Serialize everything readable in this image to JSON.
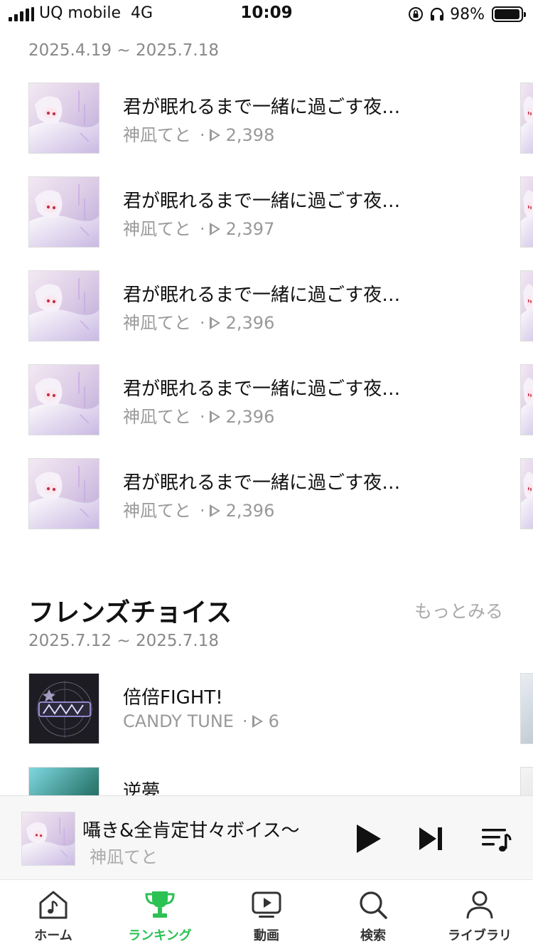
{
  "status_bar": {
    "carrier": "UQ mobile",
    "network": "4G",
    "time": "10:09",
    "battery_percent": "98%",
    "battery_level": 0.98
  },
  "section1": {
    "date_range": "2025.4.19 ~ 2025.7.18",
    "items": [
      {
        "title": "君が眠れるまで一緒に過ごす夜…",
        "artist": "神凪てと",
        "plays": "2,398"
      },
      {
        "title": "君が眠れるまで一緒に過ごす夜…",
        "artist": "神凪てと",
        "plays": "2,397"
      },
      {
        "title": "君が眠れるまで一緒に過ごす夜…",
        "artist": "神凪てと",
        "plays": "2,396"
      },
      {
        "title": "君が眠れるまで一緒に過ごす夜…",
        "artist": "神凪てと",
        "plays": "2,396"
      },
      {
        "title": "君が眠れるまで一緒に過ごす夜…",
        "artist": "神凪てと",
        "plays": "2,396"
      }
    ]
  },
  "section2": {
    "title": "フレンズチョイス",
    "more_label": "もっとみる",
    "date_range": "2025.7.12 ~ 2025.7.18",
    "items": [
      {
        "title": "倍倍FIGHT!",
        "artist": "CANDY TUNE",
        "plays": "6"
      },
      {
        "title": "逆夢"
      }
    ]
  },
  "mini_player": {
    "title": "囁き&全肯定甘々ボイス〜",
    "artist": "神凪てと"
  },
  "tabs": [
    {
      "label": "ホーム",
      "icon": "home-music-icon",
      "active": false
    },
    {
      "label": "ランキング",
      "icon": "trophy-icon",
      "active": true
    },
    {
      "label": "動画",
      "icon": "video-icon",
      "active": false
    },
    {
      "label": "検索",
      "icon": "search-icon",
      "active": false
    },
    {
      "label": "ライブラリ",
      "icon": "person-icon",
      "active": false
    }
  ],
  "colors": {
    "accent": "#2bc153",
    "text_primary": "#111111",
    "text_secondary": "#999999"
  }
}
